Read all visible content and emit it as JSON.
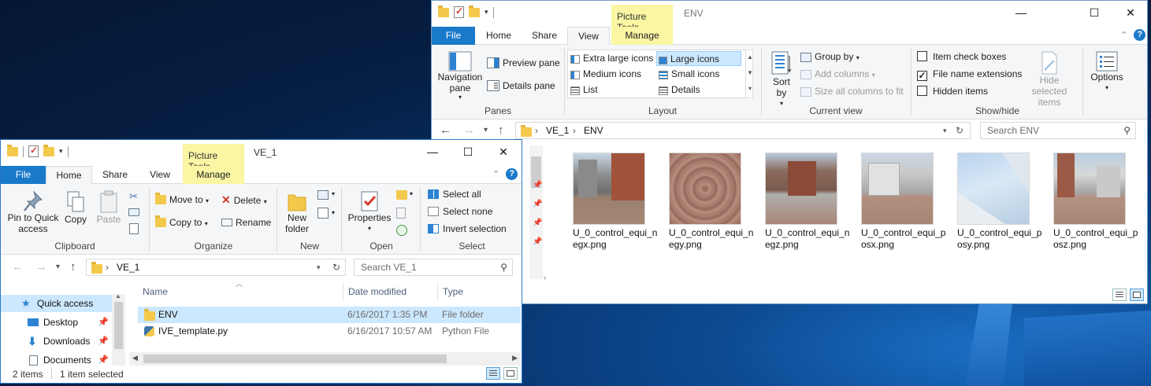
{
  "back_window": {
    "title": "ENV",
    "context_tab": "Picture Tools",
    "tabs": [
      "File",
      "Home",
      "Share",
      "View",
      "Manage"
    ],
    "ribbon": {
      "panes": {
        "label": "Panes",
        "navigation_pane": "Navigation pane",
        "preview_pane": "Preview pane",
        "details_pane": "Details pane"
      },
      "layout": {
        "label": "Layout",
        "options": [
          "Extra large icons",
          "Large icons",
          "Medium icons",
          "Small icons",
          "List",
          "Details"
        ],
        "selected": "Large icons"
      },
      "current_view": {
        "label": "Current view",
        "sort_by": "Sort by",
        "group_by": "Group by",
        "add_columns": "Add columns",
        "size_all_columns": "Size all columns to fit"
      },
      "show_hide": {
        "label": "Show/hide",
        "item_check_boxes": "Item check boxes",
        "file_name_extensions": "File name extensions",
        "hidden_items": "Hidden items",
        "hide_selected_items": "Hide selected items",
        "checked": {
          "item_check_boxes": false,
          "file_name_extensions": true,
          "hidden_items": false
        }
      },
      "options": "Options"
    },
    "address": {
      "crumbs": [
        "VE_1",
        "ENV"
      ],
      "search_placeholder": "Search ENV"
    },
    "files": [
      "U_0_control_equi_negx.png",
      "U_0_control_equi_negy.png",
      "U_0_control_equi_negz.png",
      "U_0_control_equi_posx.png",
      "U_0_control_equi_posy.png",
      "U_0_control_equi_posz.png"
    ]
  },
  "front_window": {
    "title": "VE_1",
    "context_tab": "Picture Tools",
    "tabs": [
      "File",
      "Home",
      "Share",
      "View",
      "Manage"
    ],
    "ribbon": {
      "clipboard": {
        "label": "Clipboard",
        "pin": "Pin to Quick access",
        "copy": "Copy",
        "paste": "Paste"
      },
      "organize": {
        "label": "Organize",
        "move_to": "Move to",
        "copy_to": "Copy to",
        "delete": "Delete",
        "rename": "Rename"
      },
      "new": {
        "label": "New",
        "new_folder": "New folder"
      },
      "open": {
        "label": "Open",
        "properties": "Properties"
      },
      "select": {
        "label": "Select",
        "select_all": "Select all",
        "select_none": "Select none",
        "invert_selection": "Invert selection"
      }
    },
    "address": {
      "crumbs": [
        "VE_1"
      ],
      "search_placeholder": "Search VE_1"
    },
    "nav": [
      "Quick access",
      "Desktop",
      "Downloads",
      "Documents"
    ],
    "columns": [
      "Name",
      "Date modified",
      "Type"
    ],
    "rows": [
      {
        "name": "ENV",
        "date": "6/16/2017 1:35 PM",
        "type": "File folder"
      },
      {
        "name": "IVE_template.py",
        "date": "6/16/2017 10:57 AM",
        "type": "Python File"
      }
    ],
    "status": {
      "items": "2 items",
      "selected": "1 item selected"
    }
  },
  "colors": {
    "accent": "#1979ca",
    "context_tab": "#faf6a3",
    "selection": "#cce8ff",
    "folder": "#f3c94c"
  }
}
